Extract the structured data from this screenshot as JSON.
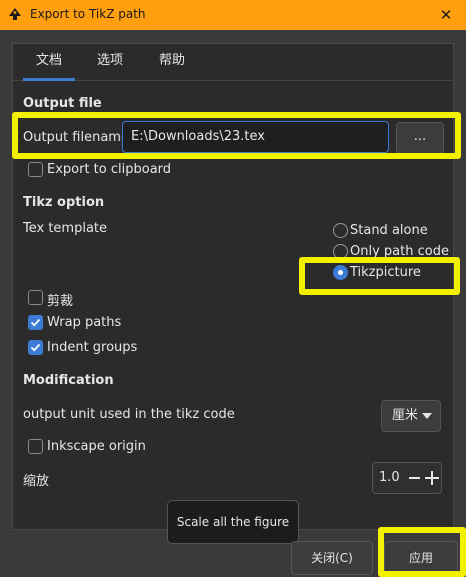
{
  "window": {
    "title": "Export to TikZ path",
    "close_glyph": "✕"
  },
  "tabs": [
    {
      "label": "文档"
    },
    {
      "label": "选项"
    },
    {
      "label": "帮助"
    }
  ],
  "output_file": {
    "heading": "Output file",
    "filename_label": "Output filename",
    "filename_value": "E:\\Downloads\\23.tex",
    "browse_label": "...",
    "clipboard_label": "Export to clipboard",
    "clipboard_checked": false
  },
  "tikz_option": {
    "heading": "Tikz option",
    "template_label": "Tex template",
    "template_options": [
      {
        "label": "Stand alone",
        "selected": false
      },
      {
        "label": "Only path code",
        "selected": false
      },
      {
        "label": "Tikzpicture",
        "selected": true
      }
    ],
    "checkboxes": [
      {
        "label": "剪裁",
        "checked": false
      },
      {
        "label": "Wrap paths",
        "checked": true
      },
      {
        "label": "Indent groups",
        "checked": true
      }
    ]
  },
  "modification": {
    "heading": "Modification",
    "unit_label": "output unit used in the tikz code",
    "unit_value": "厘米",
    "inkscape_origin_label": "Inkscape origin",
    "inkscape_origin_checked": false,
    "scale_label": "缩放",
    "scale_value": "1.0"
  },
  "tooltip": {
    "text": "Scale all the figure"
  },
  "footer": {
    "close_label": "关闭(C)",
    "apply_label": "应用"
  },
  "colors": {
    "titlebar": "#ff9f0e",
    "accent": "#3c7bd6",
    "highlight": "#f3f000",
    "background": "#2b2b2b"
  }
}
